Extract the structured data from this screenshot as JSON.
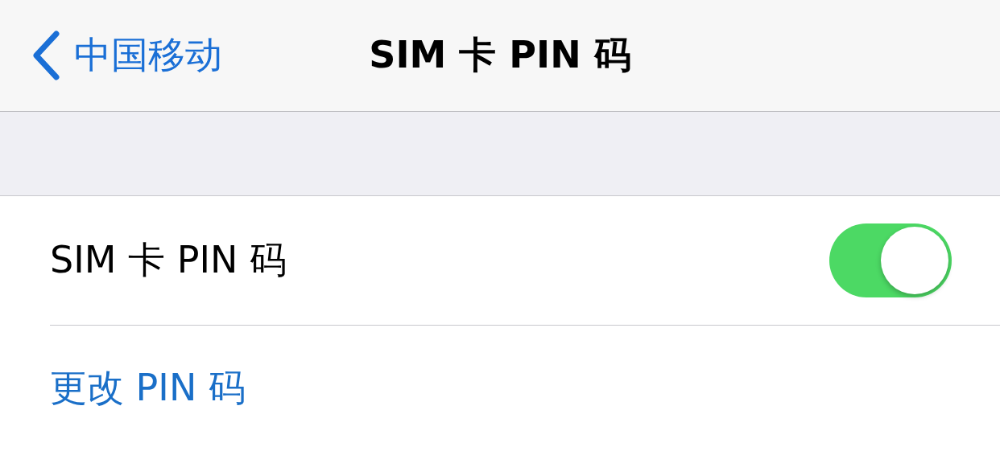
{
  "nav_bar": {
    "back_label": "中国移动",
    "title": "SIM 卡 PIN 码"
  },
  "rows": [
    {
      "kind": "toggle",
      "label": "SIM 卡 PIN 码",
      "on": true
    },
    {
      "kind": "link",
      "label": "更改 PIN 码"
    }
  ]
}
